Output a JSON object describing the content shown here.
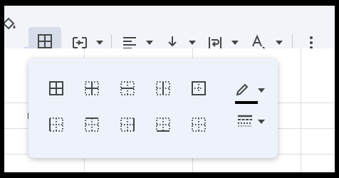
{
  "toolbar": {
    "icons": [
      "paint-bucket-icon",
      "borders-icon",
      "merge-cells-icon",
      "horizontal-align-icon",
      "vertical-align-icon",
      "text-wrap-icon",
      "text-rotation-icon",
      "more-icon"
    ],
    "active": "borders"
  },
  "sheet": {
    "visible_cell_fragment": "I"
  },
  "borders_popup": {
    "row1": [
      "all-borders",
      "inner-borders",
      "horizontal-borders",
      "vertical-borders",
      "outer-borders"
    ],
    "row2": [
      "left-border",
      "top-border",
      "right-border",
      "bottom-border",
      "clear-borders"
    ],
    "border_color": "#000000",
    "colors": {
      "accent": "#444746",
      "popup_bg": "#eef2fa",
      "toolbar_bg": "#f1f4f9"
    }
  }
}
